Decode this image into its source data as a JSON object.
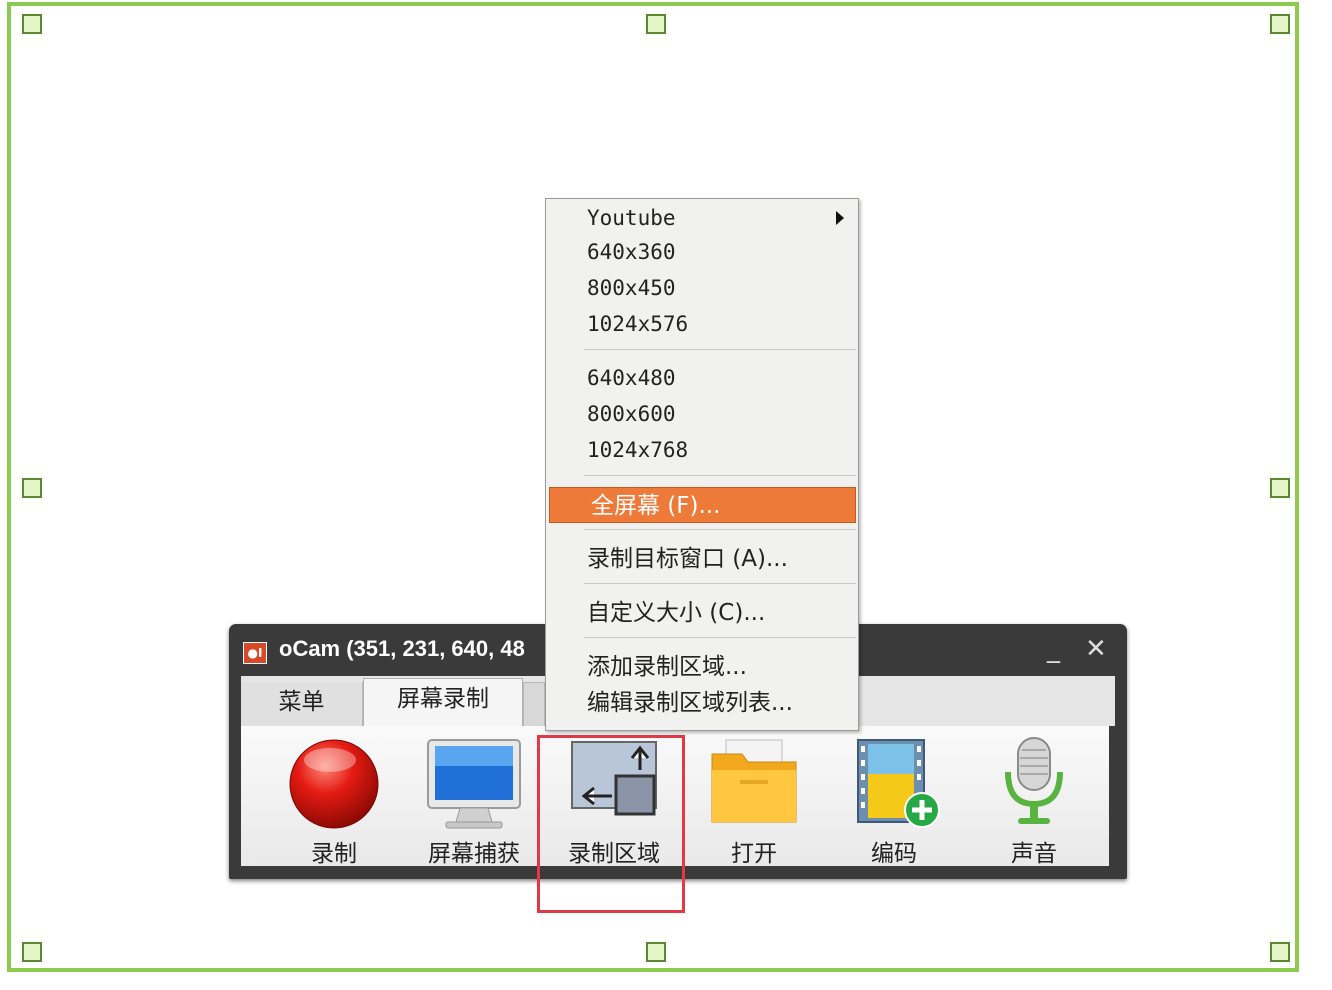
{
  "window": {
    "title": "oCam (351, 231, 640, 48",
    "icon_text": "●I",
    "minimize_glyph": "_",
    "close_glyph": "✕"
  },
  "tabs": [
    {
      "label": "菜单"
    },
    {
      "label": "屏幕录制"
    }
  ],
  "toolbar": {
    "items": [
      {
        "label": "录制",
        "icon": "record-icon"
      },
      {
        "label": "屏幕捕获",
        "icon": "monitor-icon"
      },
      {
        "label": "录制区域",
        "icon": "record-area-icon"
      },
      {
        "label": "打开",
        "icon": "folder-icon"
      },
      {
        "label": "编码",
        "icon": "codec-icon"
      },
      {
        "label": "声音",
        "icon": "microphone-icon"
      }
    ]
  },
  "context_menu": {
    "items": [
      {
        "label": "Youtube",
        "submenu": true
      },
      {
        "label": "640x360"
      },
      {
        "label": "800x450"
      },
      {
        "label": "1024x576"
      },
      {
        "label": "640x480"
      },
      {
        "label": "800x600"
      },
      {
        "label": "1024x768"
      },
      {
        "label": "全屏幕 (F)...",
        "selected": true
      },
      {
        "label": "录制目标窗口 (A)..."
      },
      {
        "label": "自定义大小 (C)..."
      },
      {
        "label": "添加录制区域..."
      },
      {
        "label": "编辑录制区域列表..."
      }
    ]
  },
  "colors": {
    "frame": "#8ccb50",
    "menu_selected": "#ee7a3a",
    "highlight_box": "#e03a46"
  }
}
